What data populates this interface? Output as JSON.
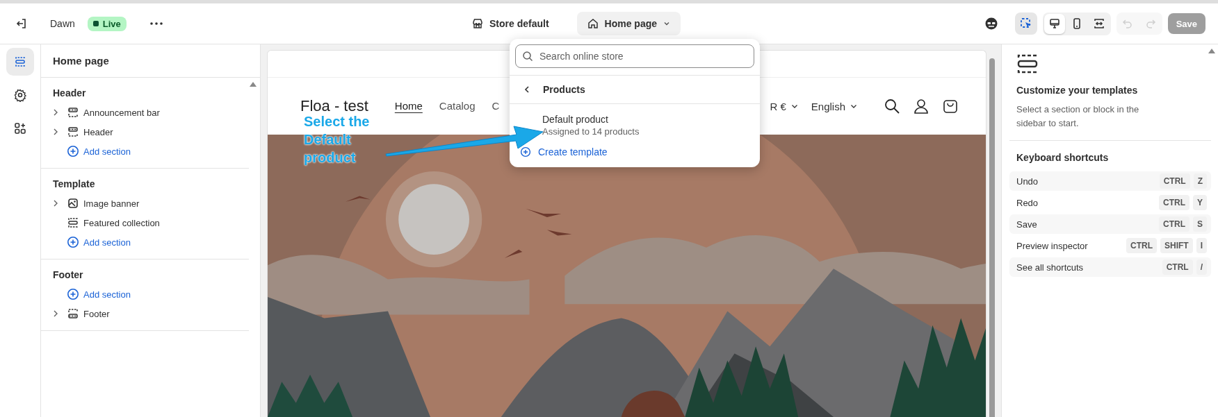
{
  "topbar": {
    "theme_name": "Dawn",
    "status_badge": "Live",
    "store_name": "Store default",
    "page_selector": "Home page",
    "inspector": {
      "selected": true
    },
    "view_modes": [
      {
        "kind": "desktop",
        "selected": true
      },
      {
        "kind": "mobile",
        "selected": false
      },
      {
        "kind": "fullwidth",
        "selected": false
      }
    ],
    "undo": {
      "disabled": true
    },
    "redo": {
      "disabled": true
    },
    "save": {
      "label": "Save",
      "disabled": true
    }
  },
  "rail": [
    {
      "kind": "sections",
      "selected": true
    },
    {
      "kind": "settings",
      "selected": false
    },
    {
      "kind": "apps",
      "selected": false
    }
  ],
  "sidebar": {
    "title": "Home page",
    "groups": [
      {
        "title": "Header",
        "items": [
          {
            "kind": "announcement",
            "label": "Announcement bar",
            "expandable": true
          },
          {
            "kind": "header",
            "label": "Header",
            "expandable": true
          },
          {
            "kind": "add",
            "label": "Add section",
            "expandable": false
          }
        ]
      },
      {
        "title": "Template",
        "items": [
          {
            "kind": "banner",
            "label": "Image banner",
            "expandable": true
          },
          {
            "kind": "collection",
            "label": "Featured collection",
            "expandable": false
          },
          {
            "kind": "add",
            "label": "Add section",
            "expandable": false
          }
        ]
      },
      {
        "title": "Footer",
        "items": [
          {
            "kind": "add",
            "label": "Add section",
            "expandable": false
          },
          {
            "kind": "footer",
            "label": "Footer",
            "expandable": true
          }
        ]
      }
    ]
  },
  "preview": {
    "store_title": "Floa - test",
    "nav": [
      {
        "label": "Home",
        "selected": true
      },
      {
        "label": "Catalog",
        "selected": false
      },
      {
        "label": "C",
        "selected": false
      }
    ],
    "currency": "R €",
    "language": "English"
  },
  "dropdown": {
    "search_placeholder": "Search online store",
    "back_title": "Products",
    "templates": [
      {
        "name": "Default product",
        "meta": "Assigned to 14 products"
      }
    ],
    "create": "Create template"
  },
  "annotation": {
    "text": "Select the Default product"
  },
  "inspector_panel": {
    "title": "Customize your templates",
    "hint": "Select a section or block in the sidebar to start.",
    "shortcuts_title": "Keyboard shortcuts",
    "shortcuts": [
      {
        "label": "Undo",
        "keys": [
          "CTRL",
          "Z"
        ]
      },
      {
        "label": "Redo",
        "keys": [
          "CTRL",
          "Y"
        ]
      },
      {
        "label": "Save",
        "keys": [
          "CTRL",
          "S"
        ]
      },
      {
        "label": "Preview inspector",
        "keys": [
          "CTRL",
          "SHIFT",
          "I"
        ]
      },
      {
        "label": "See all shortcuts",
        "keys": [
          "CTRL",
          "/"
        ]
      }
    ]
  }
}
